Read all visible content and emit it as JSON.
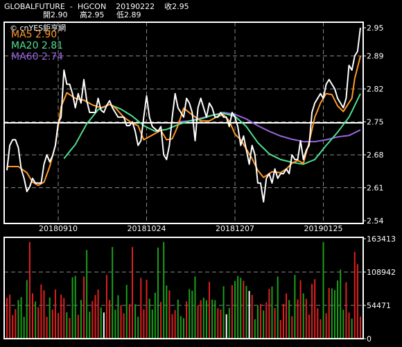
{
  "header": {
    "line1": "GLOBALFUTURE  -  HGCON    20190222    收2.95",
    "line2": "開2.90     高2.95     低2.89"
  },
  "copyright": "© cnYES鉅亨網",
  "legend": [
    {
      "label": "MA5 2.90",
      "color": "#ff9a28"
    },
    {
      "label": "MA20 2.81",
      "color": "#50e090"
    },
    {
      "label": "MA60 2.74",
      "color": "#9a66e0"
    }
  ],
  "chart_data": [
    {
      "type": "line",
      "name": "price-panel",
      "yticks": [
        "2.95",
        "2.89",
        "2.82",
        "2.75",
        "2.68",
        "2.61",
        "2.54"
      ],
      "ytick_values": [
        2.95,
        2.89,
        2.82,
        2.75,
        2.68,
        2.61,
        2.54
      ],
      "ylim": [
        2.54,
        2.95
      ],
      "xticks": [
        "20180910",
        "20181024",
        "20181207",
        "20190125"
      ],
      "xtick_index": [
        18,
        49,
        80,
        111
      ],
      "reference_line": 2.748,
      "n": 125,
      "series": [
        {
          "name": "MA5",
          "color": "#ff9a28",
          "anchors": [
            [
              0,
              2.655
            ],
            [
              4,
              2.655
            ],
            [
              7,
              2.642
            ],
            [
              9,
              2.622
            ],
            [
              11,
              2.615
            ],
            [
              13,
              2.622
            ],
            [
              15,
              2.655
            ],
            [
              17,
              2.7
            ],
            [
              19,
              2.782
            ],
            [
              21,
              2.812
            ],
            [
              24,
              2.8
            ],
            [
              27,
              2.796
            ],
            [
              30,
              2.786
            ],
            [
              33,
              2.78
            ],
            [
              36,
              2.787
            ],
            [
              38,
              2.78
            ],
            [
              41,
              2.76
            ],
            [
              44,
              2.747
            ],
            [
              46,
              2.742
            ],
            [
              48,
              2.712
            ],
            [
              51,
              2.722
            ],
            [
              54,
              2.732
            ],
            [
              56,
              2.712
            ],
            [
              58,
              2.714
            ],
            [
              60,
              2.742
            ],
            [
              62,
              2.779
            ],
            [
              65,
              2.765
            ],
            [
              68,
              2.752
            ],
            [
              71,
              2.752
            ],
            [
              74,
              2.762
            ],
            [
              76,
              2.765
            ],
            [
              78,
              2.752
            ],
            [
              80,
              2.724
            ],
            [
              82,
              2.712
            ],
            [
              84,
              2.692
            ],
            [
              86,
              2.672
            ],
            [
              88,
              2.647
            ],
            [
              90,
              2.632
            ],
            [
              93,
              2.644
            ],
            [
              96,
              2.642
            ],
            [
              98,
              2.65
            ],
            [
              100,
              2.662
            ],
            [
              102,
              2.668
            ],
            [
              104,
              2.662
            ],
            [
              106,
              2.707
            ],
            [
              108,
              2.76
            ],
            [
              110,
              2.79
            ],
            [
              112,
              2.81
            ],
            [
              114,
              2.808
            ],
            [
              116,
              2.784
            ],
            [
              118,
              2.772
            ],
            [
              121,
              2.8
            ],
            [
              122,
              2.842
            ],
            [
              124,
              2.89
            ]
          ]
        },
        {
          "name": "MA20",
          "color": "#50e090",
          "anchors": [
            [
              20,
              2.672
            ],
            [
              24,
              2.702
            ],
            [
              28,
              2.746
            ],
            [
              32,
              2.776
            ],
            [
              36,
              2.787
            ],
            [
              40,
              2.777
            ],
            [
              44,
              2.762
            ],
            [
              48,
              2.742
            ],
            [
              52,
              2.73
            ],
            [
              56,
              2.734
            ],
            [
              60,
              2.744
            ],
            [
              64,
              2.752
            ],
            [
              68,
              2.756
            ],
            [
              72,
              2.764
            ],
            [
              76,
              2.768
            ],
            [
              80,
              2.762
            ],
            [
              84,
              2.74
            ],
            [
              88,
              2.706
            ],
            [
              92,
              2.682
            ],
            [
              96,
              2.67
            ],
            [
              100,
              2.664
            ],
            [
              104,
              2.66
            ],
            [
              108,
              2.67
            ],
            [
              112,
              2.7
            ],
            [
              116,
              2.728
            ],
            [
              120,
              2.76
            ],
            [
              124,
              2.81
            ]
          ]
        },
        {
          "name": "MA60",
          "color": "#9a66e0",
          "anchors": [
            [
              60,
              2.75
            ],
            [
              64,
              2.752
            ],
            [
              68,
              2.758
            ],
            [
              72,
              2.764
            ],
            [
              76,
              2.77
            ],
            [
              80,
              2.766
            ],
            [
              84,
              2.756
            ],
            [
              88,
              2.742
            ],
            [
              92,
              2.73
            ],
            [
              96,
              2.72
            ],
            [
              100,
              2.713
            ],
            [
              104,
              2.708
            ],
            [
              108,
              2.708
            ],
            [
              112,
              2.712
            ],
            [
              116,
              2.718
            ],
            [
              120,
              2.721
            ],
            [
              124,
              2.733
            ]
          ]
        },
        {
          "name": "close",
          "color": "#ffffff",
          "anchors": [
            [
              0,
              2.647
            ],
            [
              1,
              2.7
            ],
            [
              2,
              2.712
            ],
            [
              3,
              2.712
            ],
            [
              4,
              2.695
            ],
            [
              5,
              2.65
            ],
            [
              6,
              2.63
            ],
            [
              7,
              2.602
            ],
            [
              8,
              2.612
            ],
            [
              9,
              2.63
            ],
            [
              10,
              2.62
            ],
            [
              11,
              2.62
            ],
            [
              12,
              2.62
            ],
            [
              13,
              2.66
            ],
            [
              14,
              2.68
            ],
            [
              15,
              2.665
            ],
            [
              16,
              2.678
            ],
            [
              17,
              2.7
            ],
            [
              18,
              2.748
            ],
            [
              19,
              2.76
            ],
            [
              20,
              2.86
            ],
            [
              21,
              2.83
            ],
            [
              22,
              2.83
            ],
            [
              23,
              2.81
            ],
            [
              24,
              2.78
            ],
            [
              25,
              2.81
            ],
            [
              26,
              2.79
            ],
            [
              27,
              2.84
            ],
            [
              28,
              2.795
            ],
            [
              29,
              2.77
            ],
            [
              30,
              2.77
            ],
            [
              31,
              2.77
            ],
            [
              32,
              2.8
            ],
            [
              33,
              2.775
            ],
            [
              34,
              2.77
            ],
            [
              35,
              2.785
            ],
            [
              36,
              2.795
            ],
            [
              37,
              2.78
            ],
            [
              38,
              2.77
            ],
            [
              39,
              2.76
            ],
            [
              40,
              2.76
            ],
            [
              41,
              2.76
            ],
            [
              42,
              2.742
            ],
            [
              43,
              2.742
            ],
            [
              44,
              2.75
            ],
            [
              45,
              2.73
            ],
            [
              46,
              2.7
            ],
            [
              47,
              2.71
            ],
            [
              48,
              2.76
            ],
            [
              49,
              2.805
            ],
            [
              50,
              2.76
            ],
            [
              51,
              2.74
            ],
            [
              52,
              2.735
            ],
            [
              53,
              2.73
            ],
            [
              54,
              2.74
            ],
            [
              55,
              2.68
            ],
            [
              56,
              2.67
            ],
            [
              57,
              2.7
            ],
            [
              58,
              2.76
            ],
            [
              59,
              2.81
            ],
            [
              60,
              2.78
            ],
            [
              61,
              2.77
            ],
            [
              62,
              2.76
            ],
            [
              63,
              2.8
            ],
            [
              64,
              2.79
            ],
            [
              65,
              2.77
            ],
            [
              66,
              2.71
            ],
            [
              67,
              2.78
            ],
            [
              68,
              2.8
            ],
            [
              69,
              2.78
            ],
            [
              70,
              2.76
            ],
            [
              71,
              2.79
            ],
            [
              72,
              2.78
            ],
            [
              73,
              2.76
            ],
            [
              74,
              2.76
            ],
            [
              75,
              2.77
            ],
            [
              76,
              2.76
            ],
            [
              77,
              2.76
            ],
            [
              78,
              2.74
            ],
            [
              79,
              2.77
            ],
            [
              80,
              2.76
            ],
            [
              81,
              2.74
            ],
            [
              82,
              2.7
            ],
            [
              83,
              2.72
            ],
            [
              84,
              2.69
            ],
            [
              85,
              2.66
            ],
            [
              86,
              2.7
            ],
            [
              87,
              2.68
            ],
            [
              88,
              2.62
            ],
            [
              89,
              2.62
            ],
            [
              90,
              2.58
            ],
            [
              91,
              2.63
            ],
            [
              92,
              2.64
            ],
            [
              93,
              2.62
            ],
            [
              94,
              2.65
            ],
            [
              95,
              2.63
            ],
            [
              96,
              2.64
            ],
            [
              97,
              2.64
            ],
            [
              98,
              2.65
            ],
            [
              99,
              2.64
            ],
            [
              100,
              2.68
            ],
            [
              101,
              2.67
            ],
            [
              102,
              2.67
            ],
            [
              103,
              2.71
            ],
            [
              104,
              2.67
            ],
            [
              105,
              2.69
            ],
            [
              106,
              2.7
            ],
            [
              107,
              2.77
            ],
            [
              108,
              2.79
            ],
            [
              109,
              2.8
            ],
            [
              110,
              2.81
            ],
            [
              111,
              2.8
            ],
            [
              112,
              2.83
            ],
            [
              113,
              2.84
            ],
            [
              114,
              2.83
            ],
            [
              115,
              2.82
            ],
            [
              116,
              2.8
            ],
            [
              117,
              2.79
            ],
            [
              118,
              2.78
            ],
            [
              119,
              2.8
            ],
            [
              120,
              2.87
            ],
            [
              121,
              2.86
            ],
            [
              122,
              2.89
            ],
            [
              123,
              2.9
            ],
            [
              124,
              2.95
            ]
          ]
        }
      ]
    },
    {
      "type": "bar",
      "name": "volume-panel",
      "yticks": [
        "163413",
        "108942",
        "54471",
        "0"
      ],
      "ytick_values": [
        163413,
        108942,
        54471,
        0
      ],
      "ylim": [
        0,
        163413
      ],
      "n": 125,
      "bar_colors": {
        "up": "#e02020",
        "down": "#1aa01a",
        "flat": "#ffffff"
      },
      "flat_bars": [
        34,
        77,
        85
      ],
      "highlights": [
        [
          8,
          158000
        ],
        [
          28,
          145000
        ],
        [
          37,
          150000
        ],
        [
          44,
          150000
        ],
        [
          53,
          149000
        ],
        [
          55,
          158000
        ],
        [
          111,
          158000
        ],
        [
          117,
          113000
        ],
        [
          122,
          142000
        ],
        [
          123,
          122000
        ]
      ]
    }
  ]
}
